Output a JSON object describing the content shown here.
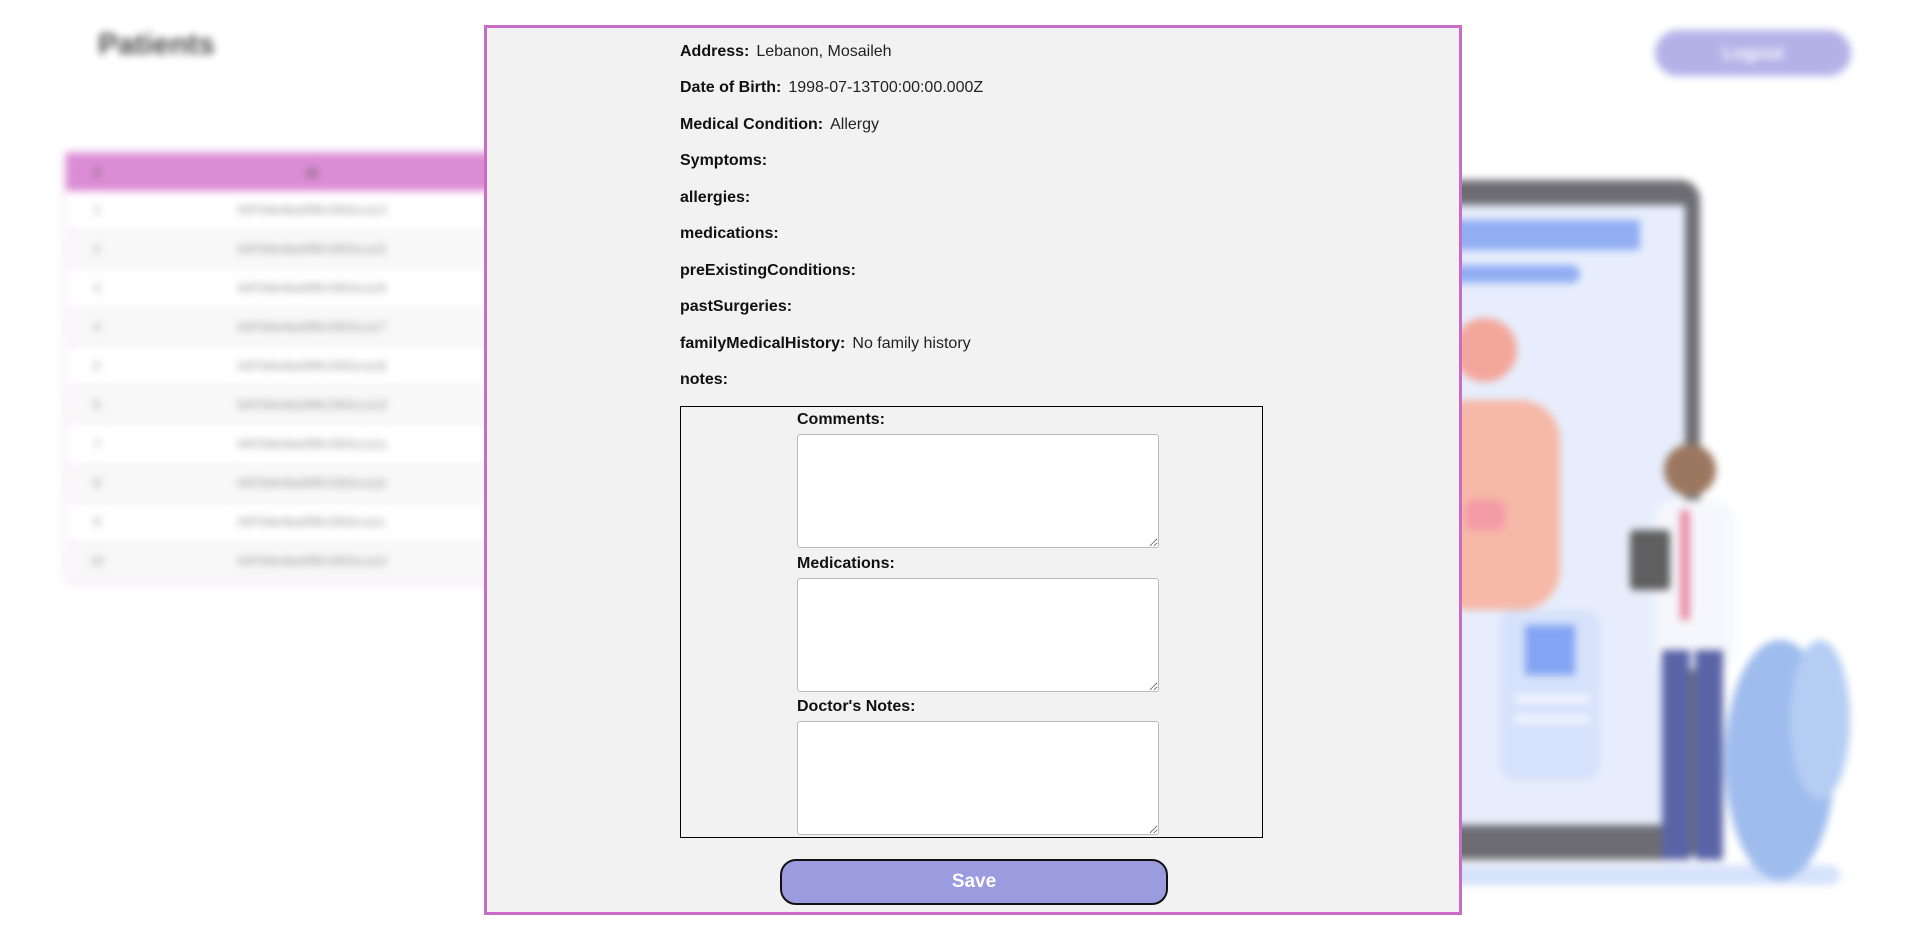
{
  "background": {
    "page_title": "Patients",
    "logout_label": "Logout",
    "table": {
      "headers": [
        "#",
        "Id"
      ],
      "rows": [
        [
          "1",
          "64f7b9e4ba0f9fc3363cca14"
        ],
        [
          "2",
          "64f7b9e4ba0f9fc3363cca15"
        ],
        [
          "3",
          "64f7b9e4ba0f9fc3363cca16"
        ],
        [
          "4",
          "64f7b9e4ba0f9fc3363cca17"
        ],
        [
          "5",
          "64f7b9e4ba0f9fc3363cca18"
        ],
        [
          "6",
          "64f7b9e4ba0f9fc3363cca19"
        ],
        [
          "7",
          "64f7b9e4ba0f9fc3363cca1a"
        ],
        [
          "8",
          "64f7b9e4ba0f9fc3363cca1b"
        ],
        [
          "9",
          "64f7b9e4ba0f9fc3363cca1c"
        ],
        [
          "10",
          "64f7b9e4ba0f9fc3363cca1d"
        ]
      ]
    },
    "colors": {
      "table_header": "#d066c6",
      "logout_button": "#9b98e0"
    }
  },
  "modal": {
    "fields": [
      {
        "label": "Address:",
        "value": "Lebanon, Mosaileh"
      },
      {
        "label": "Date of Birth:",
        "value": "1998-07-13T00:00:00.000Z"
      },
      {
        "label": "Medical Condition:",
        "value": "Allergy"
      },
      {
        "label": "Symptoms:",
        "value": ""
      },
      {
        "label": "allergies:",
        "value": ""
      },
      {
        "label": "medications:",
        "value": ""
      },
      {
        "label": "preExistingConditions:",
        "value": ""
      },
      {
        "label": "pastSurgeries:",
        "value": ""
      },
      {
        "label": "familyMedicalHistory:",
        "value": "No family history"
      },
      {
        "label": "notes:",
        "value": ""
      }
    ],
    "notes_form": {
      "comments_label": "Comments:",
      "comments_value": "",
      "medications_label": "Medications:",
      "medications_value": "",
      "doctor_notes_label": "Doctor's Notes:",
      "doctor_notes_value": ""
    },
    "save_label": "Save",
    "colors": {
      "border": "#c86cc6",
      "background": "#f1f2f1",
      "save_button": "#9b9be0"
    }
  }
}
